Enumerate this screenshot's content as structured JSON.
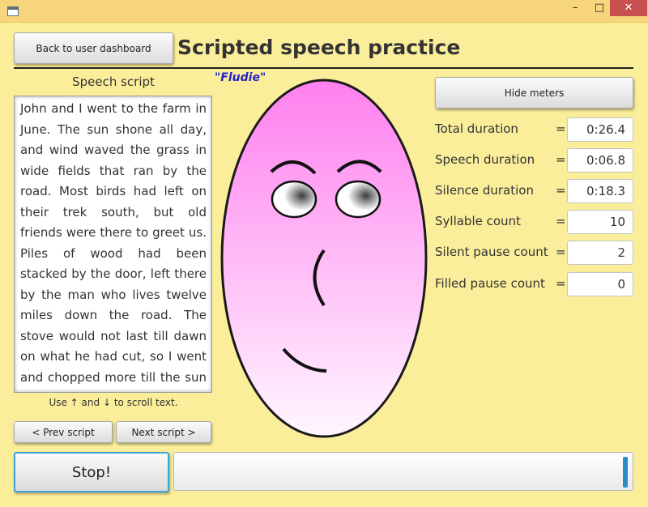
{
  "window": {
    "minimize": "–",
    "maximize": "□",
    "close": "✕"
  },
  "header": {
    "back_button": "Back to user dashboard",
    "title": "Scripted speech practice"
  },
  "script_panel": {
    "label": "Speech script",
    "character_name": "\"Fludie\"",
    "text": "John and I went to the farm in June. The sun shone all day, and wind waved the grass in wide fields that ran by the road. Most birds had left on their trek south, but old friends were there to greet us. Piles of wood had been stacked by the door, left there by the man who lives twelve miles down the road. The stove would not last till dawn on what he had cut, so I went and chopped more till the sun went down and",
    "scroll_hint": "Use ↑ and ↓ to scroll text.",
    "prev_button": "< Prev script",
    "next_button": "Next script >"
  },
  "meters": {
    "toggle_button": "Hide meters",
    "rows": [
      {
        "label": "Total duration",
        "eq": "=",
        "value": "0:26.4"
      },
      {
        "label": "Speech duration",
        "eq": "=",
        "value": "0:06.8"
      },
      {
        "label": "Silence duration",
        "eq": "=",
        "value": "0:18.3"
      },
      {
        "label": "Syllable count",
        "eq": "=",
        "value": "10"
      },
      {
        "label": "Silent pause count",
        "eq": "=",
        "value": "2"
      },
      {
        "label": "Filled pause count",
        "eq": "=",
        "value": "0"
      }
    ]
  },
  "controls": {
    "stop_button": "Stop!",
    "progress_fraction": 0.99
  },
  "colors": {
    "background": "#fbee9a",
    "face_top": "#ff80ee",
    "face_bottom": "#fff6ff",
    "character_name": "#2323c8",
    "progress": "#2a8cc8"
  }
}
